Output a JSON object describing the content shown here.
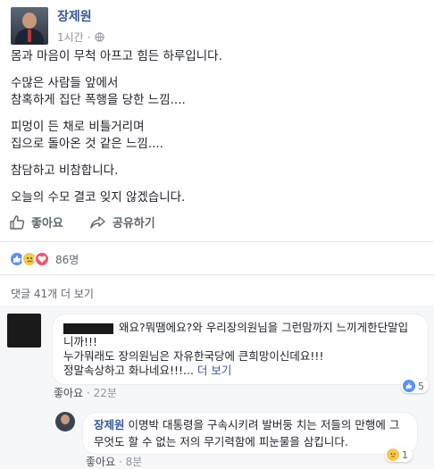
{
  "post": {
    "author": "장제원",
    "time": "1시간",
    "dot": "·",
    "paragraphs": [
      "몸과 마음이 무척 아프고 힘든 하루입니다.",
      "수많은 사람들 앞에서",
      "참혹하게 집단 폭행을 당한 느낌....",
      "피멍이 든 채로 비틀거리며",
      "집으로 돌아온 것 같은 느낌....",
      "참담하고 비참합니다.",
      "오늘의 수모 결코 잊지 않겠습니다."
    ]
  },
  "actions": {
    "like": "좋아요",
    "share": "공유하기"
  },
  "reactions": {
    "count": "86명",
    "colors": {
      "like": "#5890ff",
      "sad": "#f7c84b",
      "love": "#f25268"
    }
  },
  "comments_link": "댓글 41개 더 보기",
  "comment": {
    "text_part1": "왜요?뭐땜에요?와 우리장의원님을 그런맘까지 느끼게한단말입니까!!!",
    "text_part2": "누가뭐래도 장의원님은 자유한국당에 큰희망이신데요!!!",
    "text_part3": "정말속상하고 화나네요!!!...",
    "more": "더 보기",
    "like": "좋아요",
    "time": "22분",
    "likes": "5"
  },
  "reply": {
    "author": "장제원",
    "text": "이명박 대통령을 구속시키려 발버둥 치는 저들의 만행에 그 무엇도 할 수 없는 저의 무기력함에 피눈물을 삼킵니다.",
    "like": "좋아요",
    "time": "8분",
    "reactions": "1"
  }
}
